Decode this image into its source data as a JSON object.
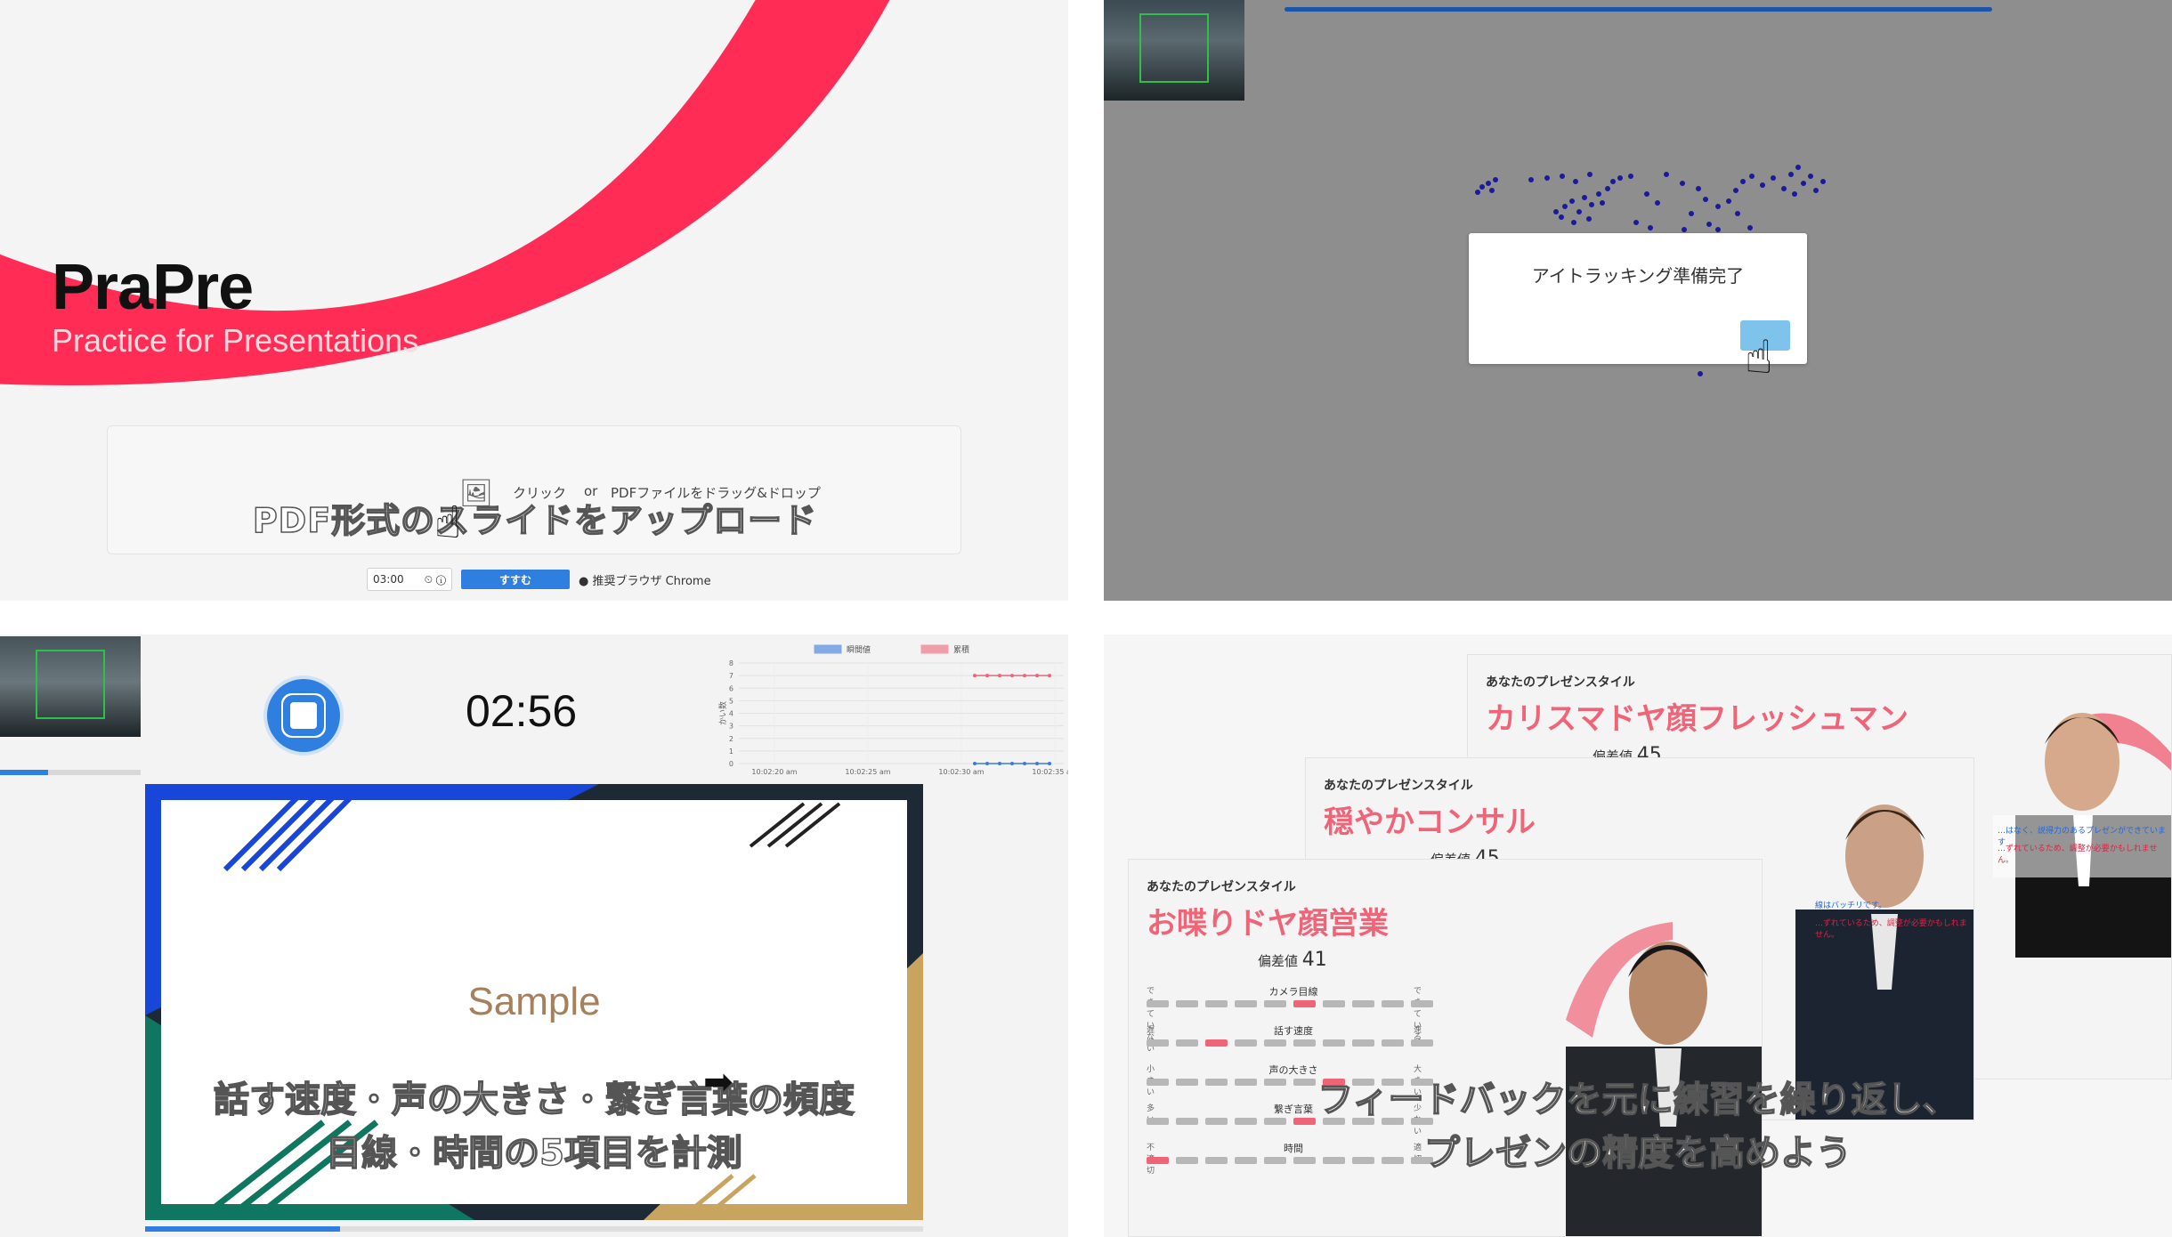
{
  "landing": {
    "app_title": "PraPre",
    "app_subtitle": "Practice for Presentations",
    "dropzone": {
      "click_label": "クリック",
      "or_label": "or",
      "drop_label": "PDFファイルをドラッグ&ドロップ",
      "caption": "PDF形式のスライドをアップロード"
    },
    "timer_value": "03:00",
    "go_label": "すすむ",
    "browser_note": "● 推奨ブラウザ Chrome",
    "accent_color": "#ff2d55"
  },
  "eye_tracking": {
    "dialog_message": "アイトラッキング準備完了"
  },
  "recording": {
    "elapsed": "02:56",
    "slide_title": "Sample",
    "caption_line1": "話す速度・声の大きさ・繋ぎ言葉の頻度",
    "caption_line2": "目線・時間の5項目を計測",
    "chart_data": {
      "type": "line",
      "ylabel": "かい数",
      "ylim": [
        0,
        8
      ],
      "yticks": [
        0,
        1,
        2,
        3,
        4,
        5,
        6,
        7,
        8
      ],
      "xticks": [
        "10:02:20 am",
        "10:02:25 am",
        "10:02:30 am",
        "10:02:35 am"
      ],
      "series": [
        {
          "name": "瞬間値",
          "color": "#3a7be0",
          "values": [
            0,
            0,
            0,
            0,
            0,
            0,
            0
          ]
        },
        {
          "name": "累積",
          "color": "#f06478",
          "values": [
            7,
            7,
            7,
            7,
            7,
            7,
            7
          ]
        }
      ]
    }
  },
  "results": {
    "style_label": "あなたのプレゼンスタイル",
    "cards": [
      {
        "type": "お喋りドヤ顔営業",
        "score_label": "偏差値",
        "score": "41"
      },
      {
        "type": "穏やかコンサル",
        "score_label": "偏差値",
        "score": "45"
      },
      {
        "type": "カリスマドヤ顔フレッシュマン",
        "score_label": "偏差値",
        "score": "45"
      }
    ],
    "metrics": [
      {
        "name": "カメラ目線",
        "left": "できていない",
        "right": "できている",
        "active": 5
      },
      {
        "name": "話す速度",
        "left": "遅い",
        "right": "速い",
        "active": 2
      },
      {
        "name": "声の大きさ",
        "left": "小さい",
        "right": "大きい",
        "active": 6
      },
      {
        "name": "繋ぎ言葉",
        "left": "多い",
        "right": "少ない",
        "active": 5
      },
      {
        "name": "時間",
        "left": "不適切",
        "right": "適切",
        "active": 0
      }
    ],
    "feedback_blue": "…はなく、説得力のあるプレゼンができています",
    "feedback_red": "…ずれているため、調整が必要かもしれません。",
    "feedback_blue2": "線はバッチリです。",
    "caption_line1": "フィードバックを元に練習を繰り返し、",
    "caption_line2": "プレゼンの精度を高めよう"
  }
}
